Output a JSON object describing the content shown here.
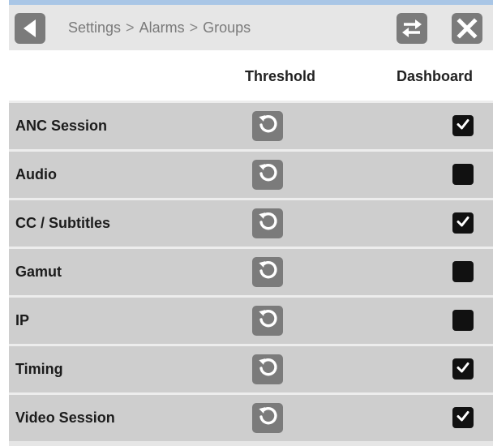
{
  "header": {
    "breadcrumb": [
      "Settings",
      "Alarms",
      "Groups"
    ],
    "separator": ">",
    "back_icon": "triangle-left-icon",
    "swap_icon": "swap-arrows-icon",
    "close_icon": "x-close-icon"
  },
  "columns": {
    "threshold": "Threshold",
    "dashboard": "Dashboard"
  },
  "rows": [
    {
      "label": "ANC Session",
      "dashboard_checked": true
    },
    {
      "label": "Audio",
      "dashboard_checked": false
    },
    {
      "label": "CC / Subtitles",
      "dashboard_checked": true
    },
    {
      "label": "Gamut",
      "dashboard_checked": false
    },
    {
      "label": "IP",
      "dashboard_checked": false
    },
    {
      "label": "Timing",
      "dashboard_checked": true
    },
    {
      "label": "Video Session",
      "dashboard_checked": true
    }
  ],
  "icons": {
    "threshold_reset": "reset-icon",
    "checkmark": "check-icon"
  },
  "colors": {
    "accent_line": "#a9c6e6",
    "header_bg": "#e6e6e6",
    "row_bg": "#cecece",
    "icon_button_bg": "#7b7b7b",
    "checkbox_bg": "#111111"
  }
}
